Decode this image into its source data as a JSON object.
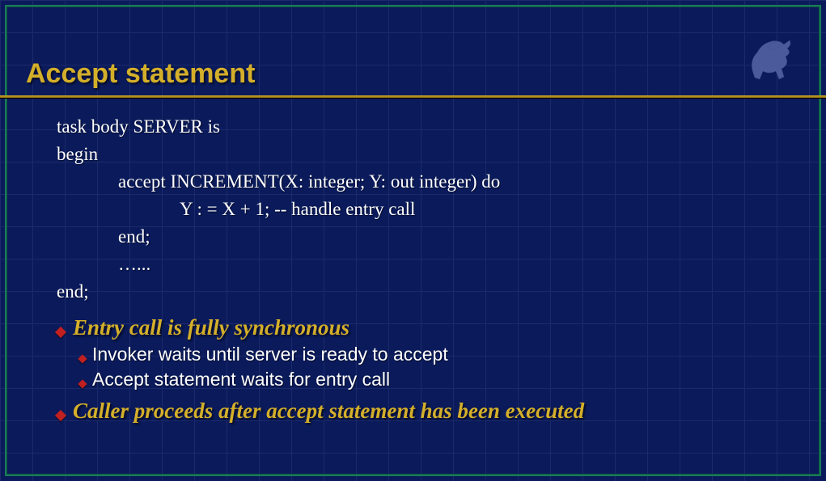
{
  "title": "Accept statement",
  "code": {
    "l1": "task body SERVER is",
    "l2": "begin",
    "l3": "accept  INCREMENT(X: integer; Y: out integer) do",
    "l4": "Y : = X + 1;  -- handle entry call",
    "l5": "end;",
    "l6": "…...",
    "l7": "end;"
  },
  "bullets": {
    "b1": "Entry call is fully synchronous",
    "b1_1": "Invoker waits until server is ready to accept",
    "b1_2": "Accept statement waits for entry call",
    "b2": "Caller proceeds after accept statement has been executed"
  }
}
